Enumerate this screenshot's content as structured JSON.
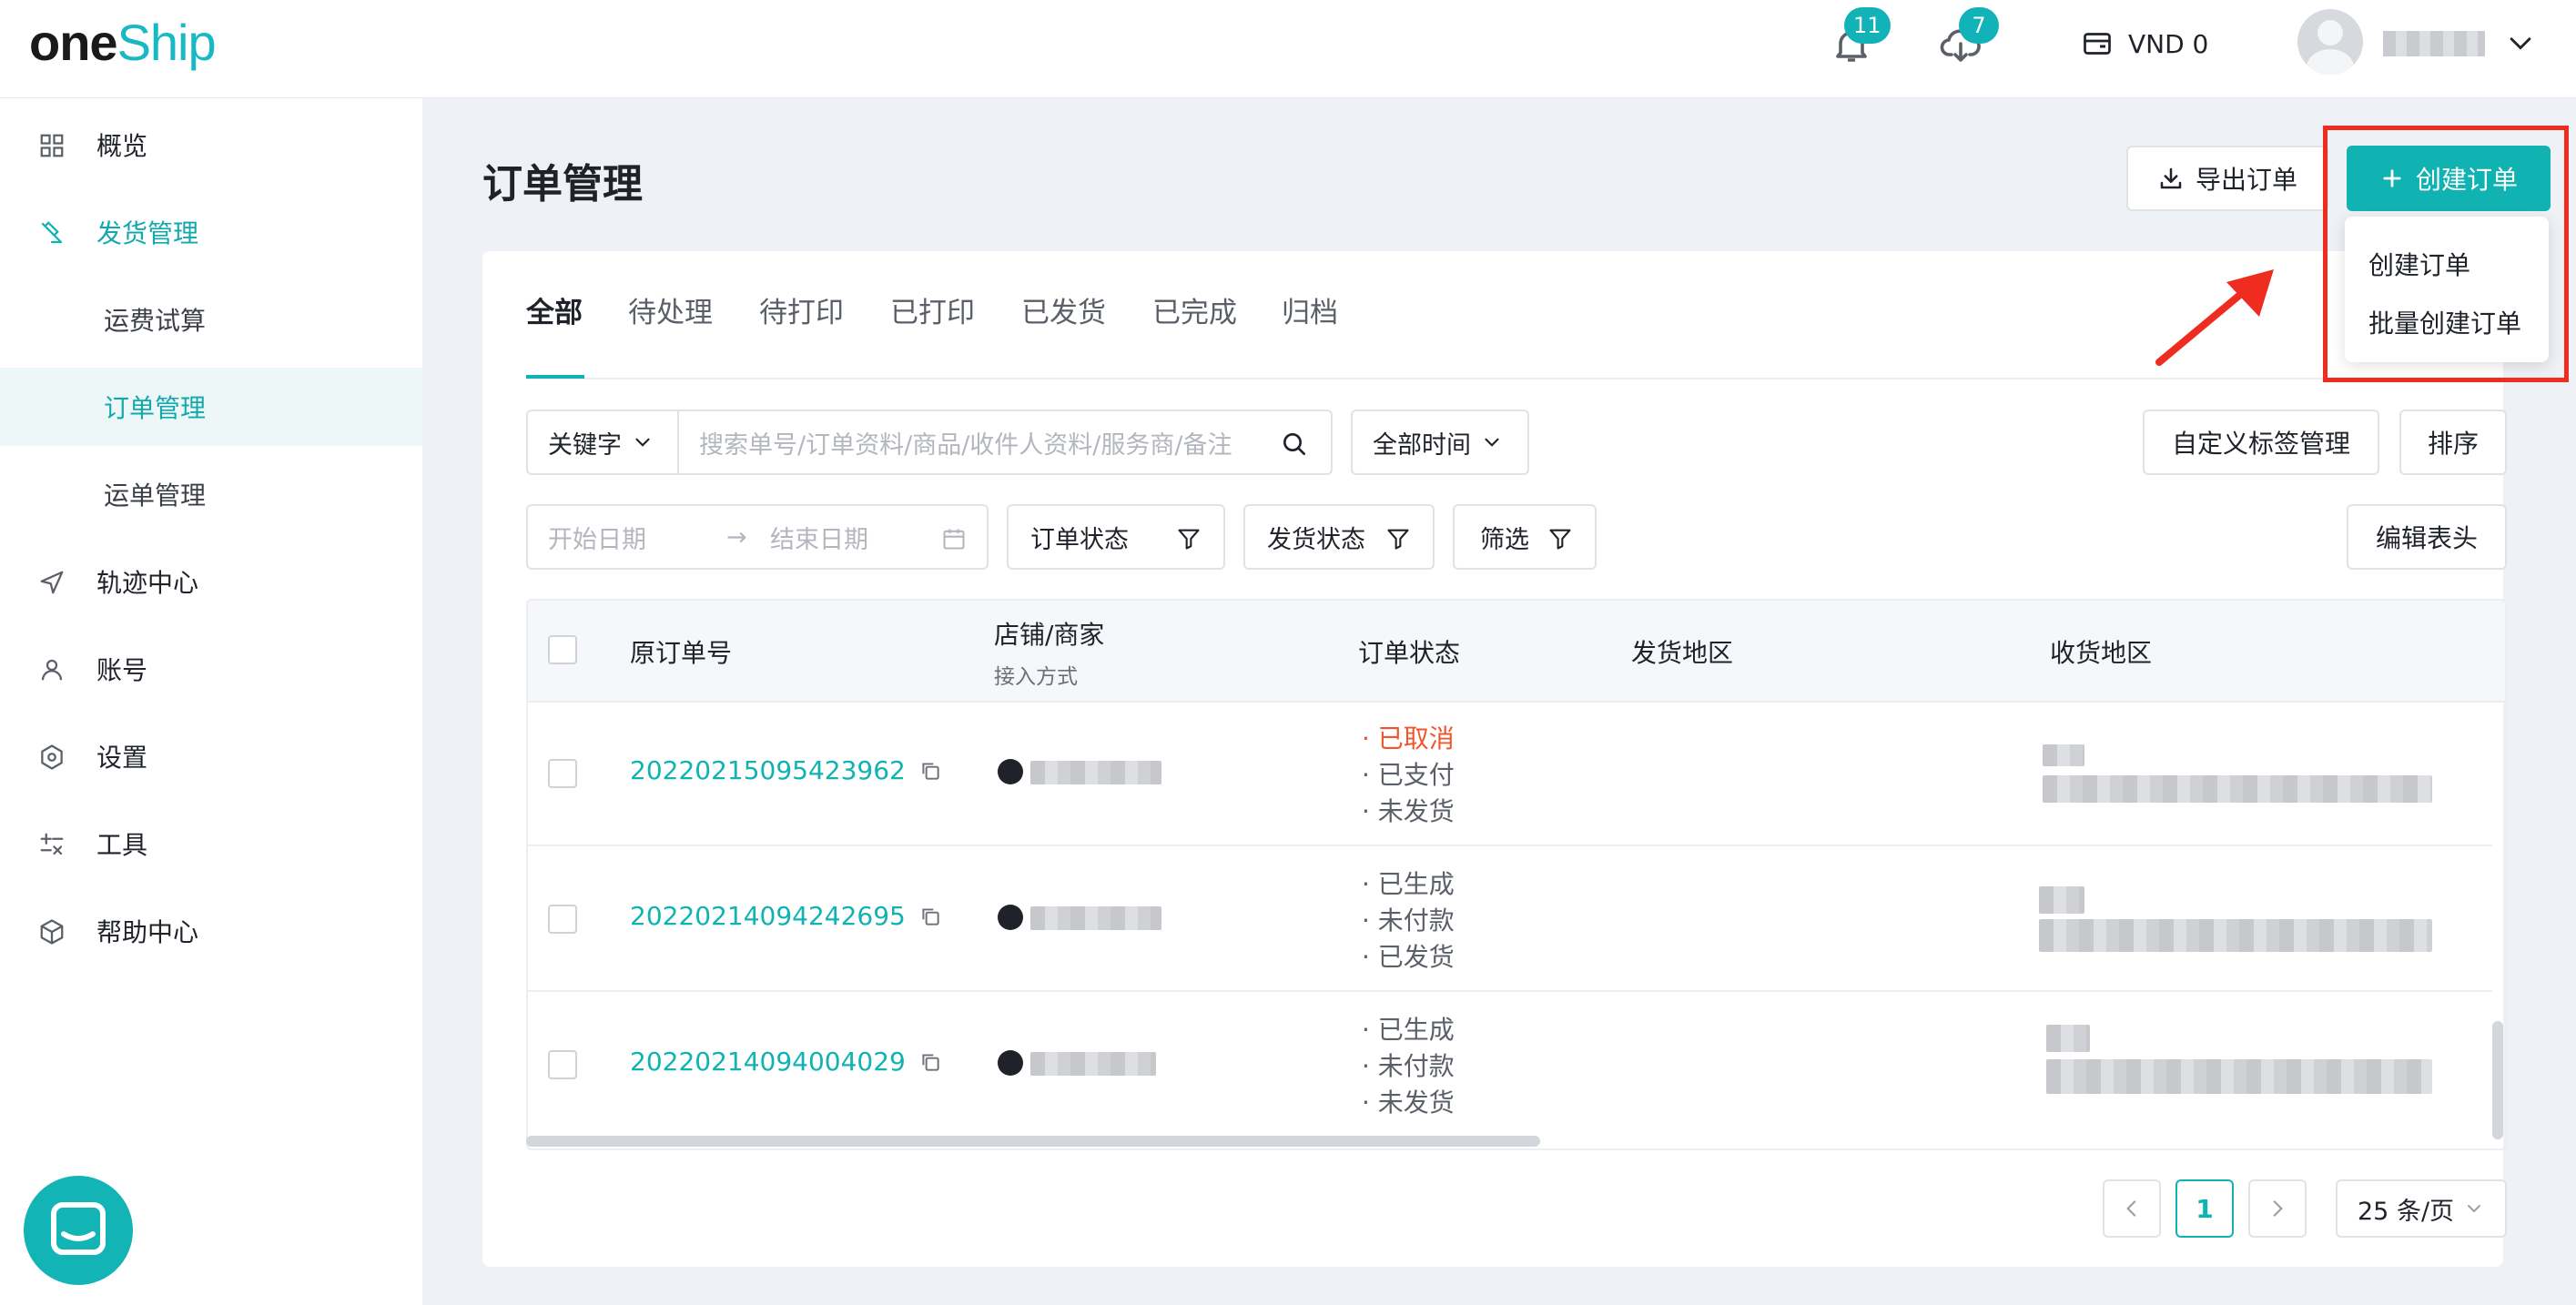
{
  "brand": {
    "logo_part1": "one",
    "logo_part2": "Ship"
  },
  "header": {
    "notification_count": "11",
    "download_count": "7",
    "wallet_label": "VND 0"
  },
  "sidebar": {
    "items": [
      {
        "label": "概览",
        "icon": "grid-icon"
      },
      {
        "label": "发货管理",
        "icon": "shipping-icon"
      },
      {
        "label": "运费试算"
      },
      {
        "label": "订单管理"
      },
      {
        "label": "运单管理"
      },
      {
        "label": "轨迹中心",
        "icon": "navigation-icon"
      },
      {
        "label": "账号",
        "icon": "user-icon"
      },
      {
        "label": "设置",
        "icon": "settings-icon"
      },
      {
        "label": "工具",
        "icon": "tools-icon"
      },
      {
        "label": "帮助中心",
        "icon": "package-icon"
      }
    ]
  },
  "page": {
    "title": "订单管理",
    "export_label": "导出订单",
    "create_label": "创建订单"
  },
  "dropdown": {
    "items": [
      "创建订单",
      "批量创建订单"
    ]
  },
  "tabs": [
    "全部",
    "待处理",
    "待打印",
    "已打印",
    "已发货",
    "已完成",
    "归档"
  ],
  "filters": {
    "keyword_label": "关键字",
    "search_placeholder": "搜索单号/订单资料/商品/收件人资料/服务商/备注",
    "time_label": "全部时间",
    "custom_tags_label": "自定义标签管理",
    "sort_label": "排序",
    "start_date": "开始日期",
    "end_date": "结束日期",
    "order_status": "订单状态",
    "ship_status": "发货状态",
    "filter_label": "筛选",
    "edit_header": "编辑表头"
  },
  "table": {
    "columns": {
      "order_no": "原订单号",
      "store": "店铺/商家",
      "access_method": "接入方式",
      "order_status": "订单状态",
      "ship_region": "发货地区",
      "receive_region": "收货地区"
    },
    "rows": [
      {
        "order_no": "20220215095423962",
        "status": [
          "· 已取消",
          "· 已支付",
          "· 未发货"
        ]
      },
      {
        "order_no": "20220214094242695",
        "status": [
          "· 已生成",
          "· 未付款",
          "· 已发货"
        ]
      },
      {
        "order_no": "20220214094004029",
        "status": [
          "· 已生成",
          "· 未付款",
          "· 未发货"
        ]
      }
    ]
  },
  "pagination": {
    "current_page": "1",
    "page_size_label": "25 条/页"
  },
  "colors": {
    "accent": "#11b3b2",
    "cancel": "#f2542d",
    "annotation": "#ee2c20"
  }
}
